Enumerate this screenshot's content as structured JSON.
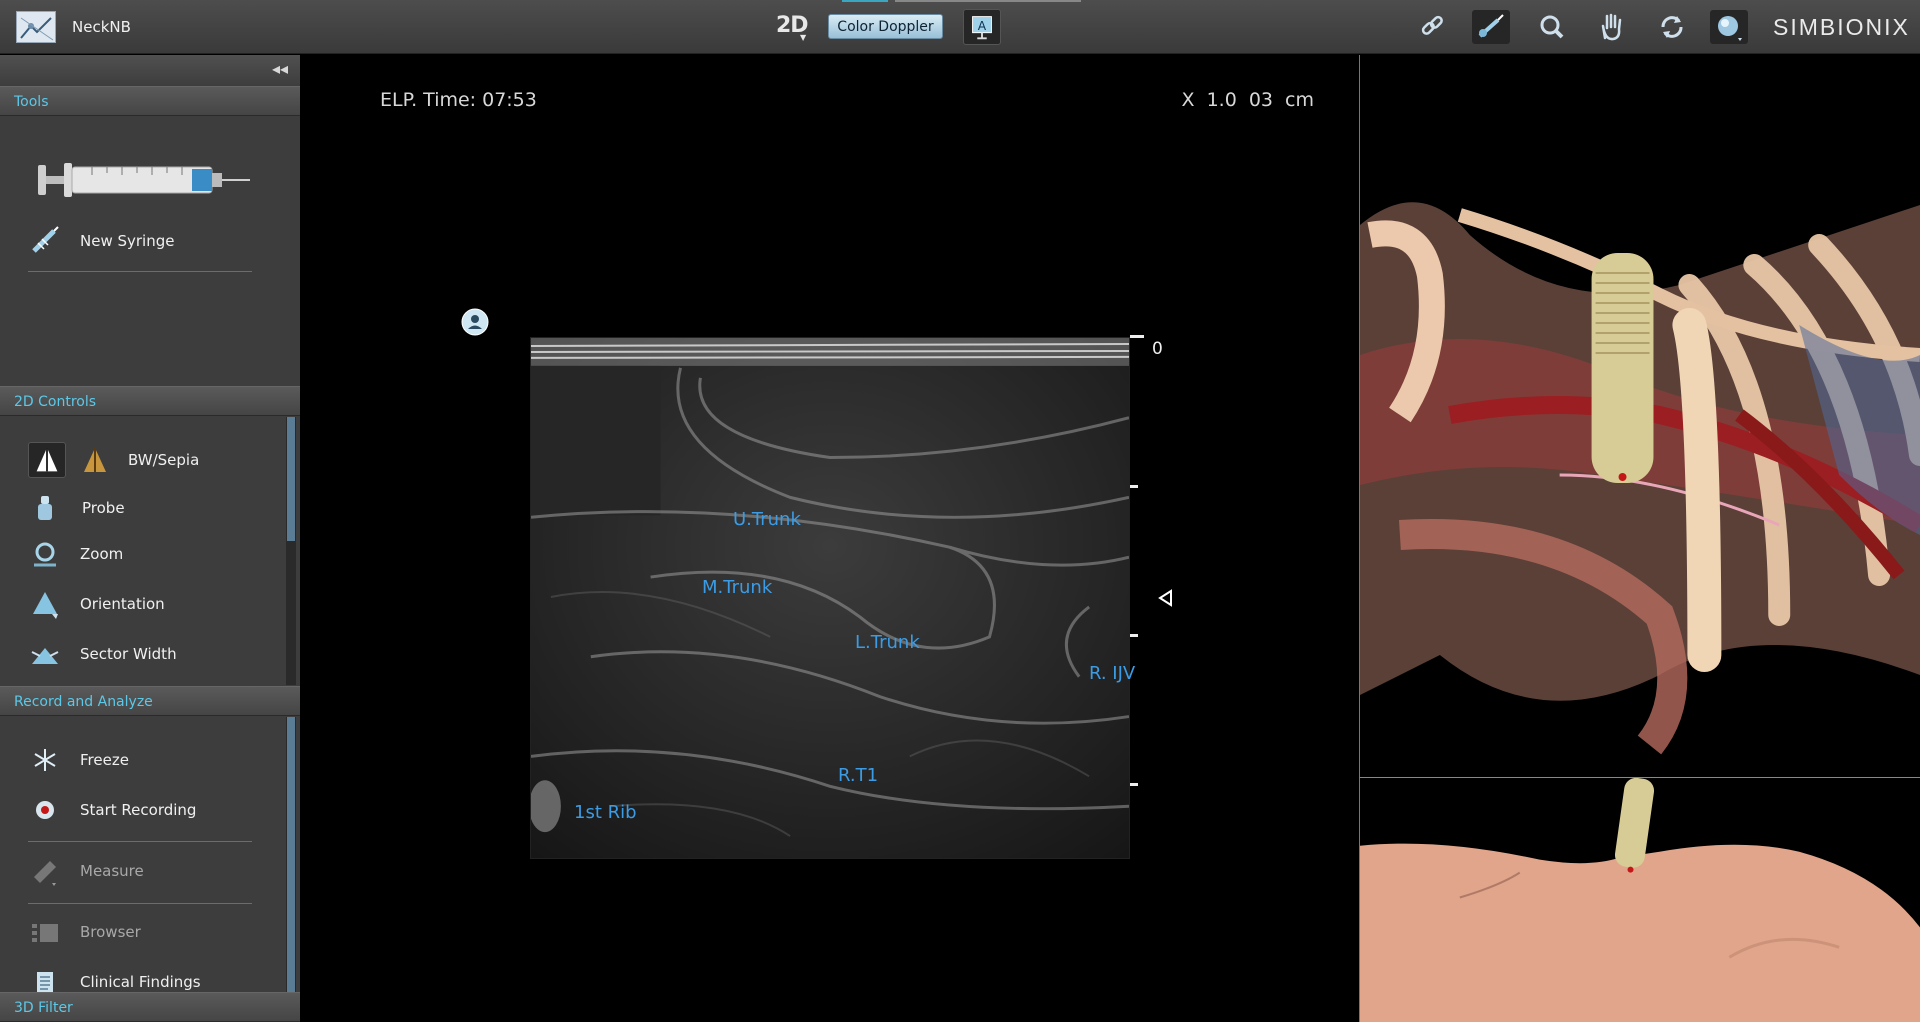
{
  "app": {
    "title": "NeckNB",
    "brand": "SIMBIONIX"
  },
  "toolbar": {
    "mode_2d": "2D",
    "color_doppler": "Color Doppler"
  },
  "toolbar_icons": [
    "link-icon",
    "needle-view-icon",
    "zoom-icon",
    "pan-hand-icon",
    "rotate-icon",
    "sphere-view-icon"
  ],
  "sidebar": {
    "collapse_glyph": "◂◂",
    "tools": {
      "header": "Tools",
      "new_syringe": "New Syringe"
    },
    "controls_2d": {
      "header": "2D Controls",
      "bw_sepia": "BW/Sepia",
      "probe": "Probe",
      "zoom": "Zoom",
      "orientation": "Orientation",
      "sector_width": "Sector Width"
    },
    "record": {
      "header": "Record and Analyze",
      "freeze": "Freeze",
      "start_recording": "Start Recording",
      "measure": "Measure",
      "browser": "Browser",
      "clinical_findings": "Clinical Findings"
    },
    "filter_3d": {
      "header": "3D Filter"
    }
  },
  "ultrasound": {
    "elapsed": "ELP. Time: 07:53",
    "zoom_depth": "X 1.0   03 cm",
    "depth_zero": "0",
    "labels": {
      "u_trunk": "U.Trunk",
      "m_trunk": "M.Trunk",
      "l_trunk": "L.Trunk",
      "r_ijv": "R. IJV",
      "r_t1": "R.T1",
      "first_rib": "1st Rib"
    }
  },
  "colors": {
    "accent": "#5cc8e8",
    "label_blue": "#3b9ce5",
    "panel": "#3d3d3d"
  }
}
